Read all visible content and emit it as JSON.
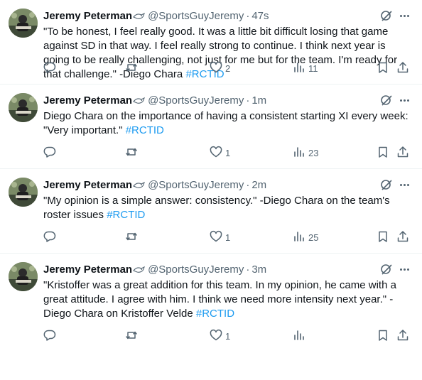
{
  "colors": {
    "accent": "#1d9bf0",
    "muted": "#536471",
    "text": "#0f1419",
    "divider": "#eff3f4"
  },
  "icons": [
    "avatar",
    "bird-badge-icon",
    "grok-icon",
    "more-icon",
    "reply-icon",
    "retweet-icon",
    "like-icon",
    "views-icon",
    "bookmark-icon",
    "share-icon"
  ],
  "tweets": [
    {
      "name": "Jeremy Peterman",
      "handle": "@SportsGuyJeremy",
      "separator": "·",
      "time": "47s",
      "text": "\"To be honest, I feel really good. It was a little bit difficult losing that game against SD in that way. I feel really strong to continue. I think next year is going to be really challenging, not just for me but for the team. I'm ready for that challenge.\" -Diego Chara ",
      "hashtag": "#RCTID",
      "reply_count": "",
      "retweet_count": "",
      "like_count": "2",
      "view_count": "11"
    },
    {
      "name": "Jeremy Peterman",
      "handle": "@SportsGuyJeremy",
      "separator": "·",
      "time": "1m",
      "text": "Diego Chara on the importance of having a consistent starting XI every week: \"Very important.\" ",
      "hashtag": "#RCTID",
      "reply_count": "",
      "retweet_count": "",
      "like_count": "1",
      "view_count": "23"
    },
    {
      "name": "Jeremy Peterman",
      "handle": "@SportsGuyJeremy",
      "separator": "·",
      "time": "2m",
      "text": "\"My opinion is a simple answer: consistency.\" -Diego Chara on the team's roster issues ",
      "hashtag": "#RCTID",
      "reply_count": "",
      "retweet_count": "",
      "like_count": "1",
      "view_count": "25"
    },
    {
      "name": "Jeremy Peterman",
      "handle": "@SportsGuyJeremy",
      "separator": "·",
      "time": "3m",
      "text": "\"Kristoffer was a great addition for this team. In my opinion, he came with a great attitude. I agree with him. I think we need more intensity next year.\" -Diego Chara on Kristoffer Velde ",
      "hashtag": "#RCTID",
      "reply_count": "",
      "retweet_count": "",
      "like_count": "1",
      "view_count": ""
    }
  ]
}
